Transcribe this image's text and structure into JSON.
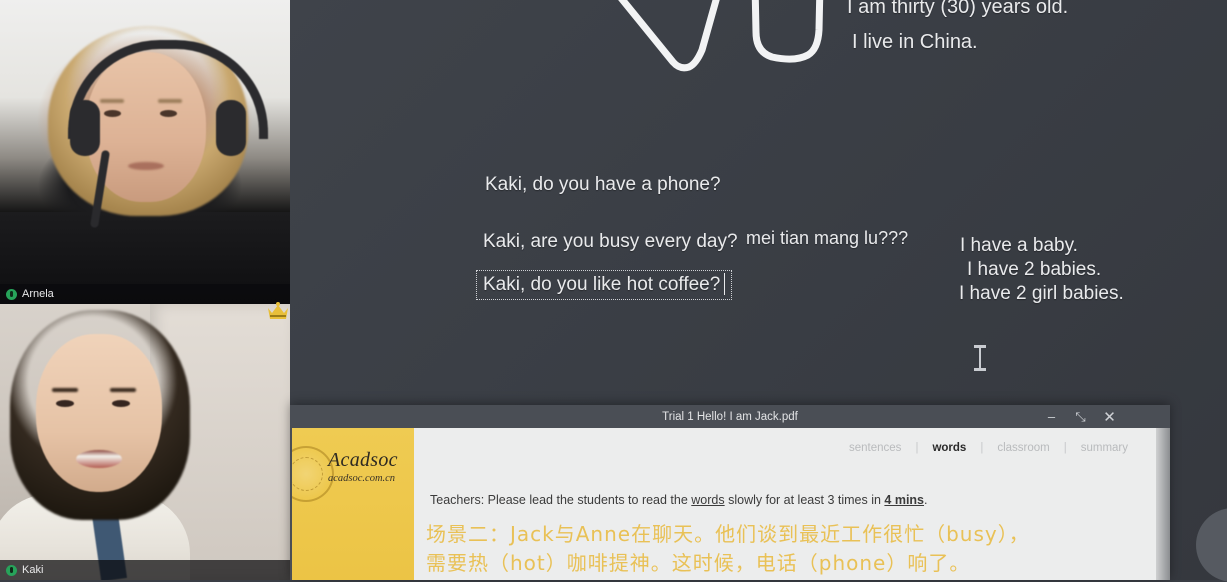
{
  "whiteboard": {
    "background_color": "#3a3e45",
    "texts": [
      {
        "id": "age",
        "content": "I am thirty (30) years old."
      },
      {
        "id": "country",
        "content": "I live in China."
      },
      {
        "id": "q_phone",
        "content": "Kaki, do you have a phone?"
      },
      {
        "id": "q_busy",
        "content": "Kaki, are you busy every day?"
      },
      {
        "id": "pinyin",
        "content": "mei tian mang lu???"
      },
      {
        "id": "q_coffee",
        "content": "Kaki, do you like hot coffee?"
      },
      {
        "id": "baby1",
        "content": "I have a baby."
      },
      {
        "id": "baby2",
        "content": "I have 2 babies."
      },
      {
        "id": "baby3",
        "content": "I have 2 girl babies."
      }
    ],
    "ink_annotations": [
      "handwritten-v-stroke",
      "handwritten-u-stroke"
    ],
    "selected_textbox": "q_coffee",
    "cursor": "text-ibeam"
  },
  "video": {
    "tiles": [
      {
        "id": "teacher",
        "name": "Arnela",
        "mic_icon": "microphone-icon",
        "mic_color": "#27a35a",
        "crown": false
      },
      {
        "id": "student",
        "name": "Kaki",
        "mic_icon": "microphone-icon",
        "mic_color": "#27a35a",
        "crown": true,
        "crown_icon": "crown-icon",
        "crown_color": "#e8bf3a"
      }
    ]
  },
  "pdf_window": {
    "title": "Trial 1 Hello! I am Jack.pdf",
    "controls": {
      "minimize": "–",
      "maximize": "⤡",
      "close": "✕",
      "minimize_icon": "minimize-icon",
      "maximize_icon": "maximize-icon",
      "close_icon": "close-icon"
    },
    "brand": {
      "name": "Acadsoc",
      "url": "acadsoc.com.cn",
      "sidebar_color": "#eec94e",
      "seal_icon": "seal-icon"
    },
    "nav": {
      "items": [
        {
          "label": "sentences",
          "active": false
        },
        {
          "label": "words",
          "active": true
        },
        {
          "label": "classroom",
          "active": false
        },
        {
          "label": "summary",
          "active": false
        }
      ],
      "separator": "|"
    },
    "instruction": {
      "prefix": "Teachers: Please lead the students to read the ",
      "emph1": "words",
      "middle": " slowly for at least 3 times in ",
      "emph2": "4 mins",
      "suffix": "."
    },
    "chinese": {
      "line1": "场景二：Jack与Anne在聊天。他们谈到最近工作很忙（busy），",
      "line2": "需要热（hot）咖啡提神。这时候，电话（phone）响了。",
      "color": "#e9c156"
    }
  },
  "edge_element": {
    "name": "floating-round-button",
    "color": "#565a61"
  }
}
